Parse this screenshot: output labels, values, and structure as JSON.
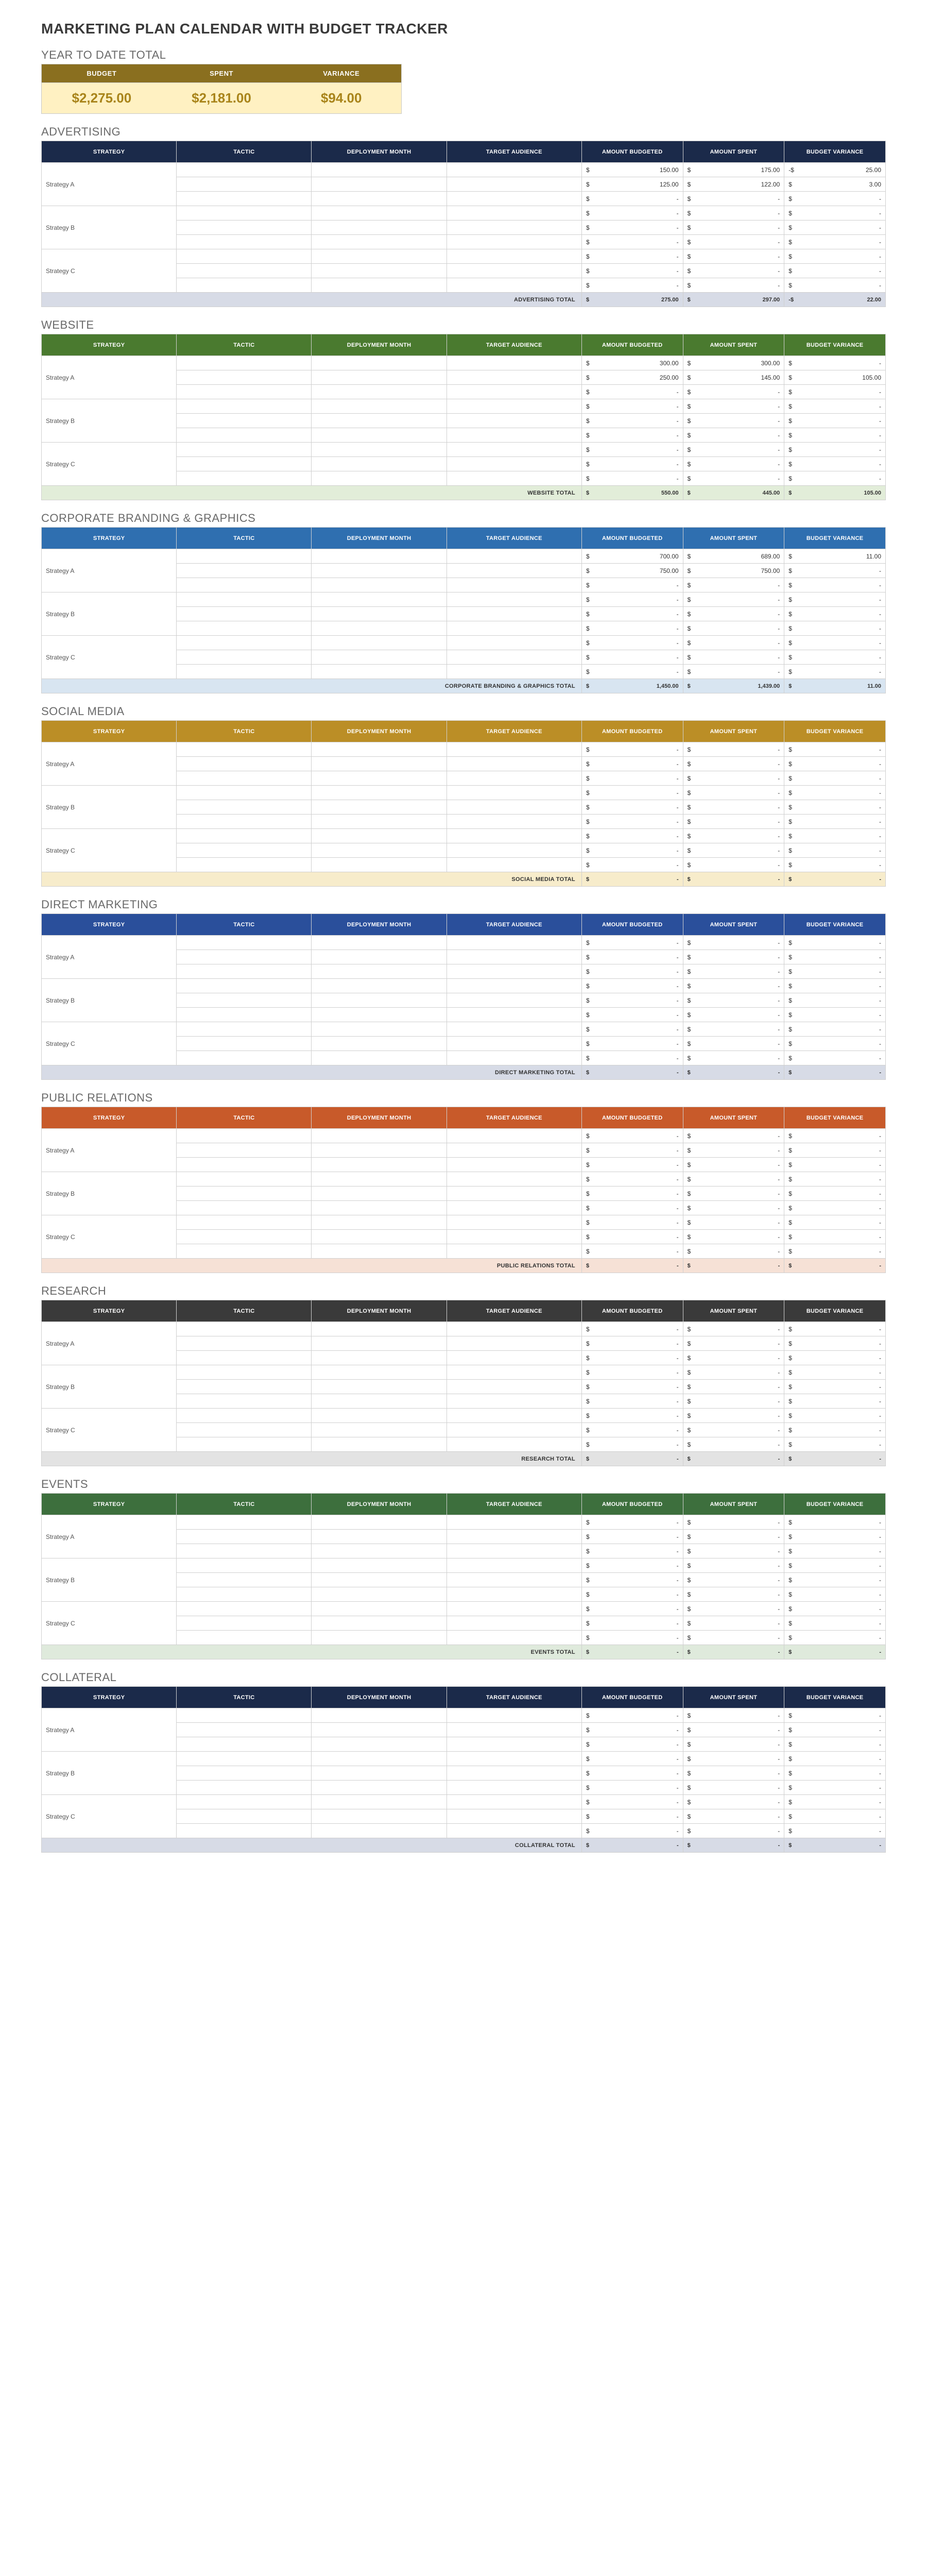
{
  "title": "MARKETING PLAN CALENDAR WITH BUDGET TRACKER",
  "ytd": {
    "heading": "YEAR TO DATE TOTAL",
    "labels": {
      "budget": "BUDGET",
      "spent": "SPENT",
      "variance": "VARIANCE"
    },
    "values": {
      "budget": "$2,275.00",
      "spent": "$2,181.00",
      "variance": "$94.00"
    },
    "colors": {
      "header_bg": "#8a6f1f",
      "value_bg": "#fff1c2",
      "value_fg": "#a9841a"
    }
  },
  "columns": {
    "strategy": "STRATEGY",
    "tactic": "TACTIC",
    "month": "DEPLOYMENT MONTH",
    "audience": "TARGET AUDIENCE",
    "budget": "AMOUNT BUDGETED",
    "spent": "AMOUNT SPENT",
    "variance": "BUDGET VARIANCE"
  },
  "currency": "$",
  "sections": [
    {
      "id": "advertising",
      "title": "ADVERTISING",
      "header_bg": "#1b2a4a",
      "total_bg": "#d7dbe6",
      "total_label": "ADVERTISING TOTAL",
      "strategies": [
        {
          "name": "Strategy A",
          "rows": [
            {
              "budget": "150.00",
              "spent": "175.00",
              "var_prefix": "-$",
              "variance": "25.00"
            },
            {
              "budget": "125.00",
              "spent": "122.00",
              "variance": "3.00"
            },
            {}
          ]
        },
        {
          "name": "Strategy B",
          "rows": [
            {},
            {},
            {}
          ]
        },
        {
          "name": "Strategy C",
          "rows": [
            {},
            {},
            {}
          ]
        }
      ],
      "totals": {
        "budget": "275.00",
        "spent": "297.00",
        "var_prefix": "-$",
        "variance": "22.00"
      }
    },
    {
      "id": "website",
      "title": "WEBSITE",
      "header_bg": "#4a7a2f",
      "total_bg": "#e2edd9",
      "total_label": "WEBSITE TOTAL",
      "strategies": [
        {
          "name": "Strategy A",
          "rows": [
            {
              "budget": "300.00",
              "spent": "300.00",
              "variance": ""
            },
            {
              "budget": "250.00",
              "spent": "145.00",
              "variance": "105.00"
            },
            {}
          ]
        },
        {
          "name": "Strategy B",
          "rows": [
            {},
            {},
            {}
          ]
        },
        {
          "name": "Strategy C",
          "rows": [
            {},
            {},
            {}
          ]
        }
      ],
      "totals": {
        "budget": "550.00",
        "spent": "445.00",
        "variance": "105.00"
      }
    },
    {
      "id": "branding",
      "title": "CORPORATE BRANDING & GRAPHICS",
      "header_bg": "#2f6fb0",
      "total_bg": "#d8e5f1",
      "total_label": "CORPORATE BRANDING & GRAPHICS TOTAL",
      "strategies": [
        {
          "name": "Strategy A",
          "rows": [
            {
              "budget": "700.00",
              "spent": "689.00",
              "variance": "11.00"
            },
            {
              "budget": "750.00",
              "spent": "750.00",
              "variance": ""
            },
            {}
          ]
        },
        {
          "name": "Strategy B",
          "rows": [
            {},
            {},
            {}
          ]
        },
        {
          "name": "Strategy C",
          "rows": [
            {},
            {},
            {}
          ]
        }
      ],
      "totals": {
        "budget": "1,450.00",
        "spent": "1,439.00",
        "variance": "11.00"
      }
    },
    {
      "id": "social",
      "title": "SOCIAL MEDIA",
      "header_bg": "#bb8e26",
      "total_bg": "#f7eccb",
      "total_label": "SOCIAL MEDIA TOTAL",
      "strategies": [
        {
          "name": "Strategy A",
          "rows": [
            {},
            {},
            {}
          ]
        },
        {
          "name": "Strategy B",
          "rows": [
            {},
            {},
            {}
          ]
        },
        {
          "name": "Strategy C",
          "rows": [
            {},
            {},
            {}
          ]
        }
      ],
      "totals": {
        "budget": "-",
        "spent": "-",
        "variance": "-"
      }
    },
    {
      "id": "direct",
      "title": "DIRECT MARKETING",
      "header_bg": "#2a4f9b",
      "total_bg": "#d7dbe6",
      "total_label": "DIRECT MARKETING TOTAL",
      "strategies": [
        {
          "name": "Strategy A",
          "rows": [
            {},
            {},
            {}
          ]
        },
        {
          "name": "Strategy B",
          "rows": [
            {},
            {},
            {}
          ]
        },
        {
          "name": "Strategy C",
          "rows": [
            {},
            {},
            {}
          ]
        }
      ],
      "totals": {
        "budget": "-",
        "spent": "-",
        "variance": "-"
      }
    },
    {
      "id": "pr",
      "title": "PUBLIC RELATIONS",
      "header_bg": "#c85a2a",
      "total_bg": "#f6e1d6",
      "total_label": "PUBLIC RELATIONS TOTAL",
      "strategies": [
        {
          "name": "Strategy A",
          "rows": [
            {},
            {},
            {}
          ]
        },
        {
          "name": "Strategy B",
          "rows": [
            {},
            {},
            {}
          ]
        },
        {
          "name": "Strategy C",
          "rows": [
            {},
            {},
            {}
          ]
        }
      ],
      "totals": {
        "budget": "-",
        "spent": "-",
        "variance": "-"
      }
    },
    {
      "id": "research",
      "title": "RESEARCH",
      "header_bg": "#3a3a3a",
      "total_bg": "#e3e3e3",
      "total_label": "RESEARCH TOTAL",
      "strategies": [
        {
          "name": "Strategy A",
          "rows": [
            {},
            {},
            {}
          ]
        },
        {
          "name": "Strategy B",
          "rows": [
            {},
            {},
            {}
          ]
        },
        {
          "name": "Strategy C",
          "rows": [
            {},
            {},
            {}
          ]
        }
      ],
      "totals": {
        "budget": "-",
        "spent": "-",
        "variance": "-"
      }
    },
    {
      "id": "events",
      "title": "EVENTS",
      "header_bg": "#3d6f3d",
      "total_bg": "#dfeadc",
      "total_label": "EVENTS TOTAL",
      "strategies": [
        {
          "name": "Strategy A",
          "rows": [
            {},
            {},
            {}
          ]
        },
        {
          "name": "Strategy B",
          "rows": [
            {},
            {},
            {}
          ]
        },
        {
          "name": "Strategy C",
          "rows": [
            {},
            {},
            {}
          ]
        }
      ],
      "totals": {
        "budget": "-",
        "spent": "-",
        "variance": "-"
      }
    },
    {
      "id": "collateral",
      "title": "COLLATERAL",
      "header_bg": "#1b2a4a",
      "total_bg": "#d7dbe6",
      "total_label": "COLLATERAL TOTAL",
      "strategies": [
        {
          "name": "Strategy A",
          "rows": [
            {},
            {},
            {}
          ]
        },
        {
          "name": "Strategy B",
          "rows": [
            {},
            {},
            {}
          ]
        },
        {
          "name": "Strategy C",
          "rows": [
            {},
            {},
            {}
          ]
        }
      ],
      "totals": {
        "budget": "-",
        "spent": "-",
        "variance": "-"
      }
    }
  ]
}
